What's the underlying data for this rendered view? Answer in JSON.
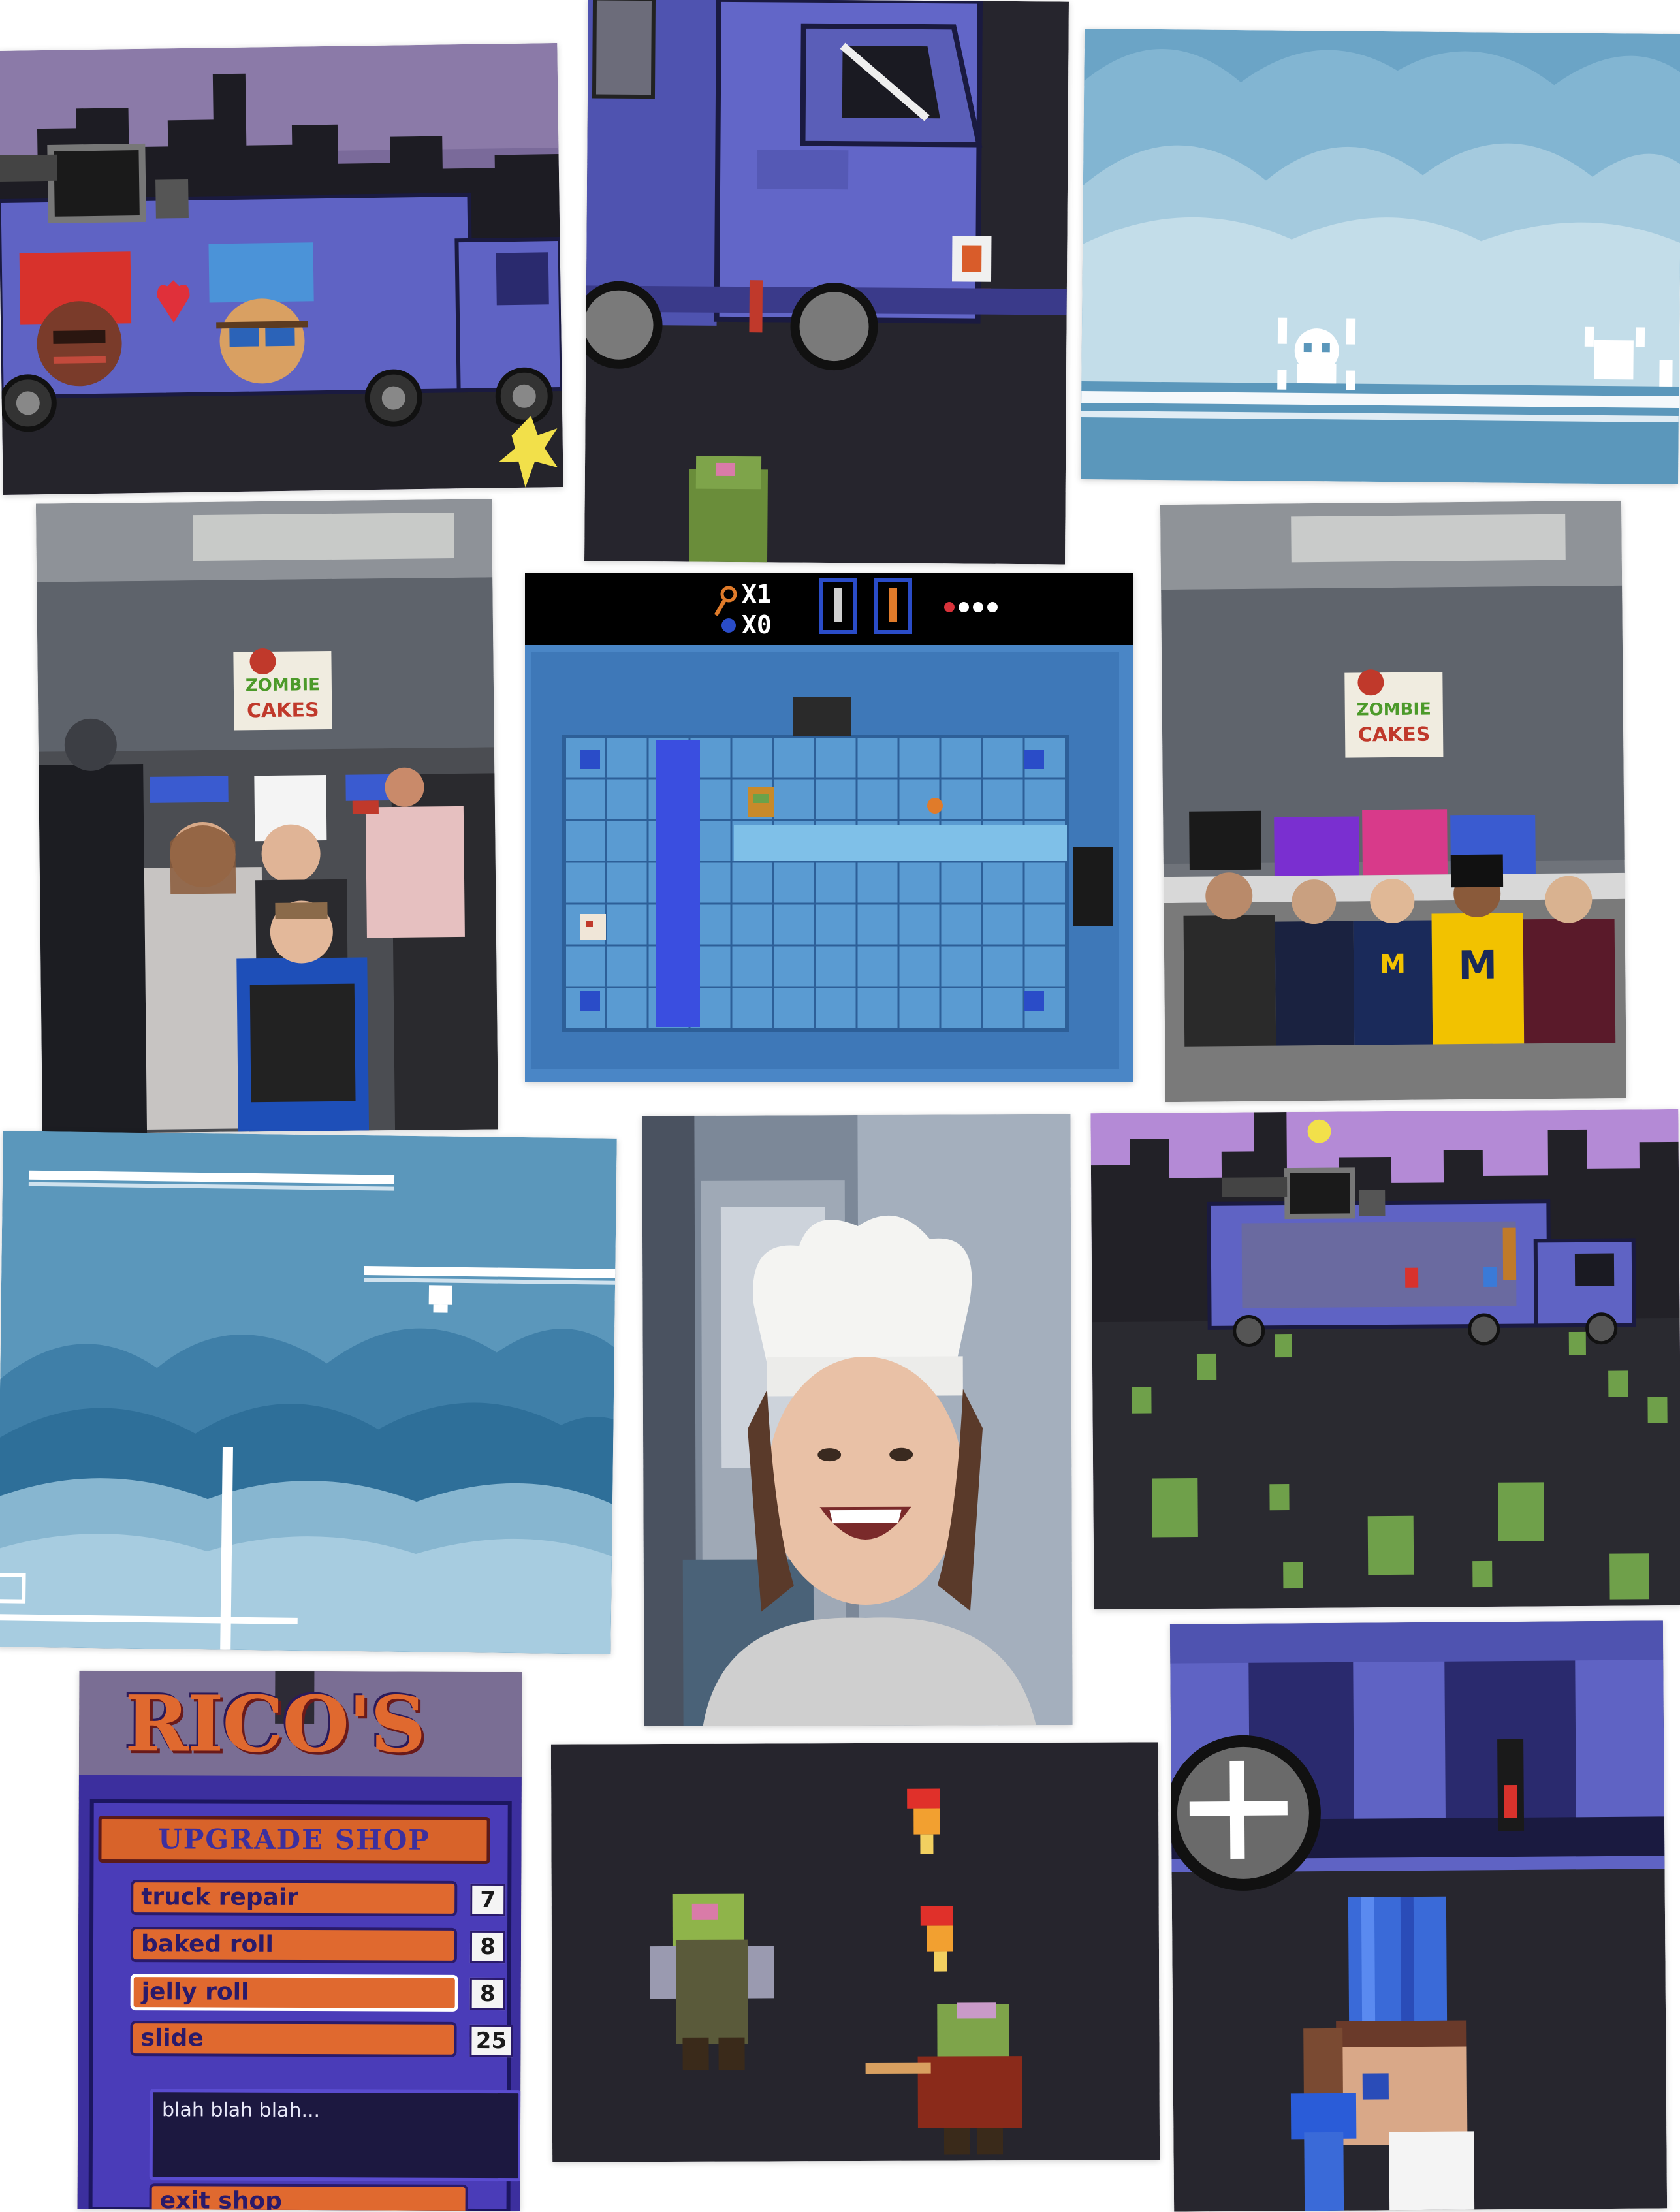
{
  "collage": {
    "background": "#ffffff"
  },
  "tiles": {
    "truck_mural": {
      "label": "Food truck with zombie-chef mural"
    },
    "truck_closeup": {
      "label": "Truck cab close-up"
    },
    "sky_skulls": {
      "label": "Sky stage with skull enemies"
    },
    "family_photo": {
      "label": "Family at Zombie Cakes booth",
      "sign_line1": "ZOMBIE",
      "sign_line2": "CAKES"
    },
    "dungeon": {
      "label": "Dungeon room level",
      "hud_keys": "X1",
      "hud_bombs": "X0",
      "hearts": 3
    },
    "team_photo": {
      "label": "Team photo at booth",
      "sign_line1": "ZOMBIE",
      "sign_line2": "CAKES",
      "shirt_letter": "M"
    },
    "cloud_platforms": {
      "label": "Cloud platform level"
    },
    "chef_selfie": {
      "label": "Selfie in chef hat"
    },
    "truck_night": {
      "label": "Truck at night with zombie horde"
    },
    "upgrade_shop": {
      "title": "RICO'S",
      "subtitle": "UPGRADE SHOP",
      "items": [
        {
          "name": "truck repair",
          "price": "7"
        },
        {
          "name": "baked roll",
          "price": "8"
        },
        {
          "name": "jelly roll",
          "price": "8"
        },
        {
          "name": "slide",
          "price": "25"
        }
      ],
      "selected_index": 2,
      "dialog": "blah blah blah...",
      "exit": "exit shop"
    },
    "zombie_fight": {
      "label": "Zombies throwing flaming pizza"
    },
    "chef_closeup": {
      "label": "Blue-hat chef with key close-up"
    }
  },
  "colors": {
    "truck_blue": "#5f63c4",
    "truck_dark": "#2a2a6e",
    "sky_blue": "#5b97bb",
    "cloud_light": "#8fbdd6",
    "night": "#27262e",
    "dungeon_blue": "#4a86c6",
    "shop_purple": "#3c2f9e",
    "shop_orange": "#e0692f",
    "zombie_green": "#6fa04a"
  }
}
